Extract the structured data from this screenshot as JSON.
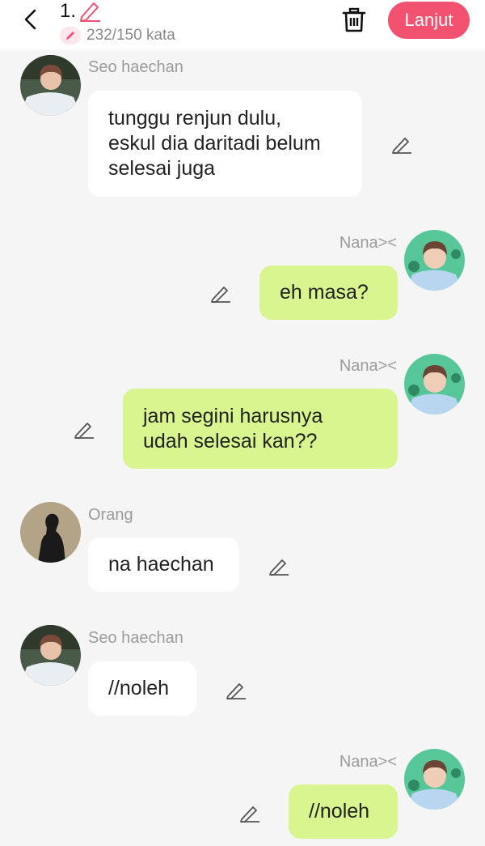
{
  "header": {
    "title_number": "1.",
    "word_count": "232/150 kata",
    "next_label": "Lanjut"
  },
  "colors": {
    "accent": "#f2516f",
    "incoming_bubble": "#ffffff",
    "outgoing_bubble": "#d9f58f",
    "background": "#f5f5f5"
  },
  "messages": [
    {
      "sender": "Seo haechan",
      "text": "tunggu renjun dulu,\neskul dia daritadi belum\nselesai juga",
      "side": "left"
    },
    {
      "sender": "Nana><",
      "text": "eh masa?",
      "side": "right"
    },
    {
      "sender": "Nana><",
      "text": "jam segini harusnya\nudah selesai kan??",
      "side": "right"
    },
    {
      "sender": "Orang",
      "text": "na haechan",
      "side": "left"
    },
    {
      "sender": "Seo haechan",
      "text": "//noleh",
      "side": "left"
    },
    {
      "sender": "Nana><",
      "text": "//noleh",
      "side": "right"
    }
  ]
}
